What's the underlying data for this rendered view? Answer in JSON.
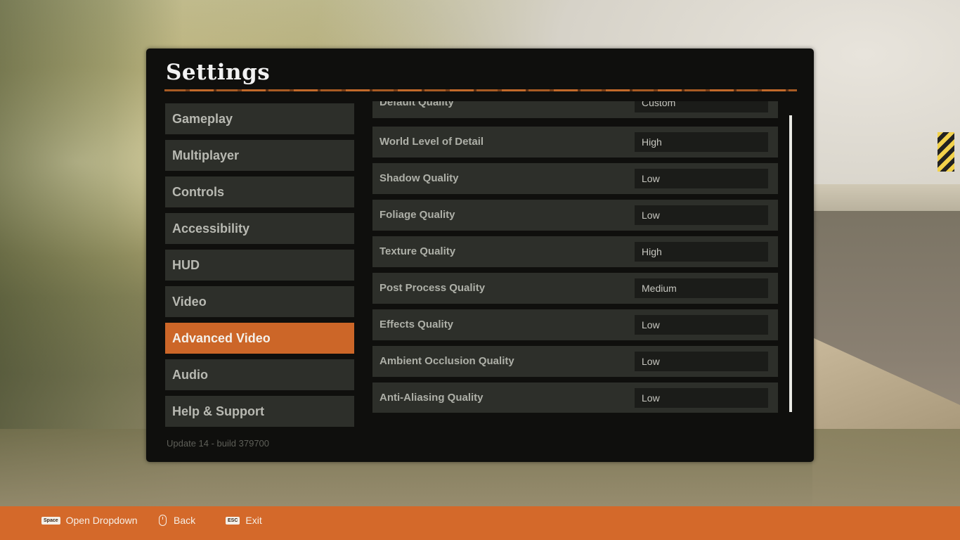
{
  "title": "Settings",
  "nav": {
    "items": [
      {
        "label": "Gameplay",
        "active": false
      },
      {
        "label": "Multiplayer",
        "active": false
      },
      {
        "label": "Controls",
        "active": false
      },
      {
        "label": "Accessibility",
        "active": false
      },
      {
        "label": "HUD",
        "active": false
      },
      {
        "label": "Video",
        "active": false
      },
      {
        "label": "Advanced Video",
        "active": true
      },
      {
        "label": "Audio",
        "active": false
      },
      {
        "label": "Help & Support",
        "active": false
      }
    ]
  },
  "settings": [
    {
      "label": "Default Quality",
      "value": "Custom"
    },
    {
      "label": "World Level of Detail",
      "value": "High"
    },
    {
      "label": "Shadow Quality",
      "value": "Low"
    },
    {
      "label": "Foliage Quality",
      "value": "Low"
    },
    {
      "label": "Texture Quality",
      "value": "High"
    },
    {
      "label": "Post Process Quality",
      "value": "Medium"
    },
    {
      "label": "Effects Quality",
      "value": "Low"
    },
    {
      "label": "Ambient Occlusion Quality",
      "value": "Low"
    },
    {
      "label": "Anti-Aliasing Quality",
      "value": "Low"
    }
  ],
  "build_info": "Update 14 - build 379700",
  "footer": {
    "hints": [
      {
        "key": "Space",
        "label": "Open Dropdown",
        "icon": "space-key-icon"
      },
      {
        "key": "",
        "label": "Back",
        "icon": "mouse-icon"
      },
      {
        "key": "ESC",
        "label": "Exit",
        "icon": "esc-key-icon"
      }
    ]
  },
  "colors": {
    "accent": "#cc6628",
    "panel": "#0f0f0d",
    "item": "#2d2f2a",
    "footer": "#d4692a"
  }
}
